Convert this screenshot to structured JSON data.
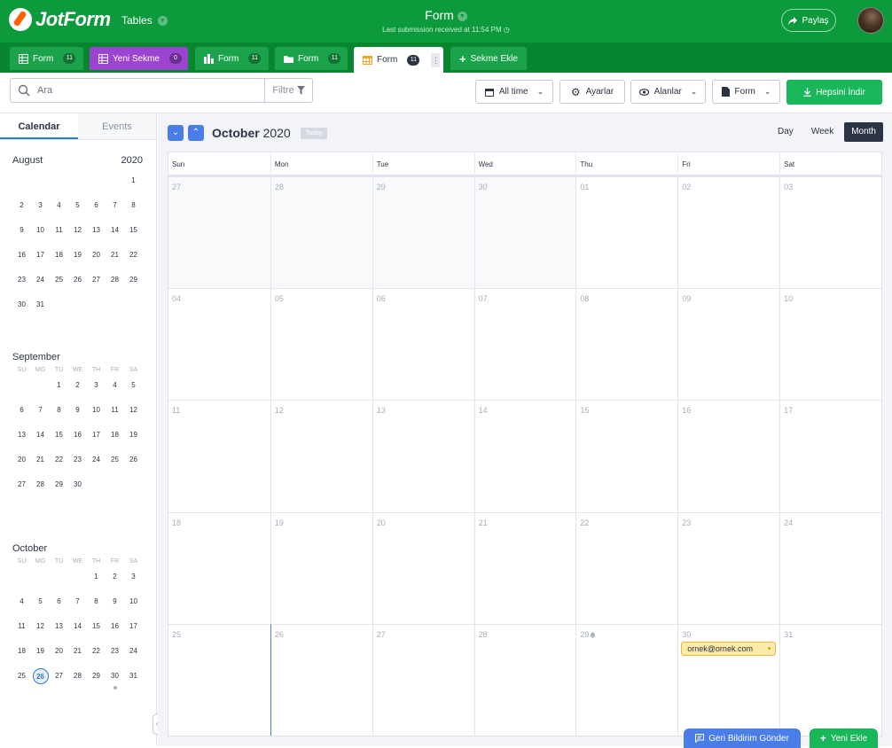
{
  "app": {
    "brand": "JotForm",
    "product": "Tables",
    "title": "Form",
    "subtitle": "Last submission received at 11:54 PM",
    "share_label": "Paylaş"
  },
  "tabs": [
    {
      "label": "Form",
      "badge": "11",
      "color": "#1aa34a"
    },
    {
      "label": "Yeni Sekme",
      "badge": "0",
      "color": "#9b44cf"
    },
    {
      "label": "Form",
      "badge": "11",
      "color": "#1aa34a"
    },
    {
      "label": "Form",
      "badge": "11",
      "color": "#1aa34a"
    },
    {
      "label": "Form",
      "badge": "11",
      "color": "#ffffff"
    },
    {
      "label": "Sekme Ekle",
      "badge": "",
      "color": "#1aa34a"
    }
  ],
  "toolbar": {
    "search_placeholder": "Ara",
    "filter_label": "Filtre",
    "alltime_label": "All time",
    "settings_label": "Ayarlar",
    "fields_label": "Alanlar",
    "form_label": "Form",
    "download_label": "Hepsini İndir"
  },
  "sidebar": {
    "tabs": [
      "Calendar",
      "Events"
    ],
    "weekdays": [
      "SU",
      "MO",
      "TU",
      "WE",
      "TH",
      "FR",
      "SA"
    ],
    "months": [
      {
        "name": "August",
        "year": "2020",
        "days": [
          "",
          "",
          "",
          "",
          "",
          "",
          "1",
          "2",
          "3",
          "4",
          "5",
          "6",
          "7",
          "8",
          "9",
          "10",
          "11",
          "12",
          "13",
          "14",
          "15",
          "16",
          "17",
          "18",
          "19",
          "20",
          "21",
          "22",
          "23",
          "24",
          "25",
          "26",
          "27",
          "28",
          "29",
          "30",
          "31"
        ]
      },
      {
        "name": "September",
        "year": "",
        "days": [
          "",
          "",
          "1",
          "2",
          "3",
          "4",
          "5",
          "6",
          "7",
          "8",
          "9",
          "10",
          "11",
          "12",
          "13",
          "14",
          "15",
          "16",
          "17",
          "18",
          "19",
          "20",
          "21",
          "22",
          "23",
          "24",
          "25",
          "26",
          "27",
          "28",
          "29",
          "30"
        ]
      },
      {
        "name": "October",
        "year": "",
        "days": [
          "",
          "",
          "",
          "",
          "1",
          "2",
          "3",
          "4",
          "5",
          "6",
          "7",
          "8",
          "9",
          "10",
          "11",
          "12",
          "13",
          "14",
          "15",
          "16",
          "17",
          "18",
          "19",
          "20",
          "21",
          "22",
          "23",
          "24",
          "25",
          "26",
          "27",
          "28",
          "29",
          "30",
          "31"
        ]
      }
    ]
  },
  "calendar": {
    "month": "October",
    "year": "2020",
    "today_label": "Today",
    "views": [
      "Day",
      "Week",
      "Month"
    ],
    "active_view": "Month",
    "weekday_headers": [
      "Sun",
      "Mon",
      "Tue",
      "Wed",
      "Thu",
      "Fri",
      "Sat"
    ],
    "weeks": [
      [
        "27",
        "28",
        "29",
        "30",
        "01",
        "02",
        "03"
      ],
      [
        "04",
        "05",
        "06",
        "07",
        "08",
        "09",
        "10"
      ],
      [
        "11",
        "12",
        "13",
        "14",
        "15",
        "16",
        "17"
      ],
      [
        "18",
        "19",
        "20",
        "21",
        "22",
        "23",
        "24"
      ],
      [
        "25",
        "26",
        "27",
        "28",
        "29",
        "30",
        "31"
      ]
    ],
    "event_text": "ornek@ornek.com"
  },
  "footer": {
    "feedback_label": "Geri Bildirim Gönder",
    "addnew_label": "Yeni Ekle"
  }
}
